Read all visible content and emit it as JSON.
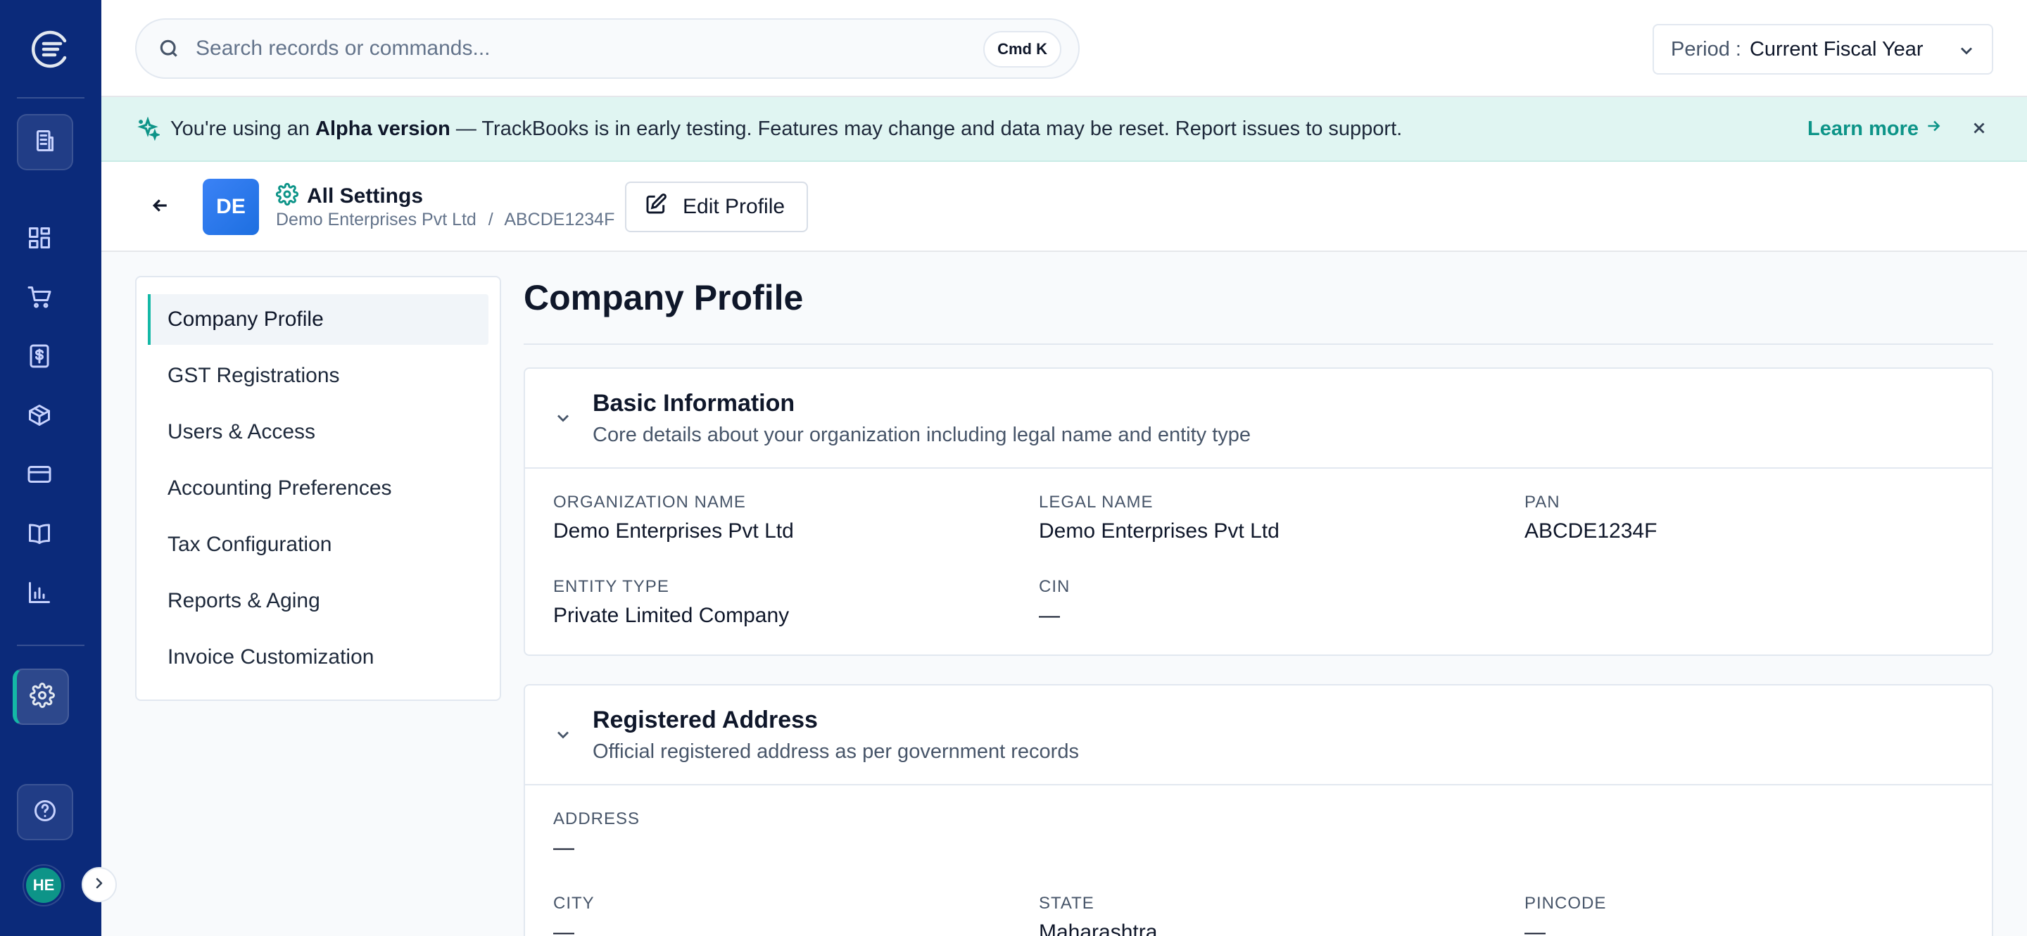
{
  "colors": {
    "sidebar": "#0b2a7a",
    "accent": "#0d9488",
    "banner_bg": "#e0f5f2",
    "avatar_bg": "#3b82f6"
  },
  "sidebar": {
    "logo": "trackbooks-logo-icon",
    "nav": [
      "building-icon",
      "dashboard-icon",
      "cart-icon",
      "invoice-icon",
      "package-icon",
      "credit-card-icon",
      "book-icon",
      "chart-icon",
      "settings-icon",
      "help-icon"
    ],
    "user_initials": "HE"
  },
  "search": {
    "placeholder": "Search records or commands...",
    "shortcut": "Cmd K"
  },
  "period": {
    "label": "Period :",
    "value": "Current Fiscal Year"
  },
  "banner": {
    "prefix": "You're using an ",
    "bold": "Alpha version",
    "suffix": " — TrackBooks is in early testing. Features may change and data may be reset. Report issues to support.",
    "link": "Learn more"
  },
  "header": {
    "badge": "DE",
    "title": "All Settings",
    "company": "Demo Enterprises Pvt Ltd",
    "separator": "/",
    "pan": "ABCDE1234F",
    "edit_label": "Edit Profile"
  },
  "settings_nav": [
    {
      "label": "Company Profile",
      "active": true
    },
    {
      "label": "GST Registrations"
    },
    {
      "label": "Users & Access"
    },
    {
      "label": "Accounting Preferences"
    },
    {
      "label": "Tax Configuration"
    },
    {
      "label": "Reports & Aging"
    },
    {
      "label": "Invoice Customization"
    }
  ],
  "page_title": "Company Profile",
  "basic": {
    "title": "Basic Information",
    "subtitle": "Core details about your organization including legal name and entity type",
    "fields": [
      {
        "label": "Organization Name",
        "value": "Demo Enterprises Pvt Ltd"
      },
      {
        "label": "Legal Name",
        "value": "Demo Enterprises Pvt Ltd"
      },
      {
        "label": "PAN",
        "value": "ABCDE1234F"
      },
      {
        "label": "Entity Type",
        "value": "Private Limited Company"
      },
      {
        "label": "CIN",
        "value": "—"
      }
    ]
  },
  "address": {
    "title": "Registered Address",
    "subtitle": "Official registered address as per government records",
    "fields": [
      {
        "label": "Address",
        "value": "—"
      },
      {
        "label": "City",
        "value": "—"
      },
      {
        "label": "State",
        "value": "Maharashtra"
      },
      {
        "label": "Pincode",
        "value": "—"
      }
    ]
  }
}
